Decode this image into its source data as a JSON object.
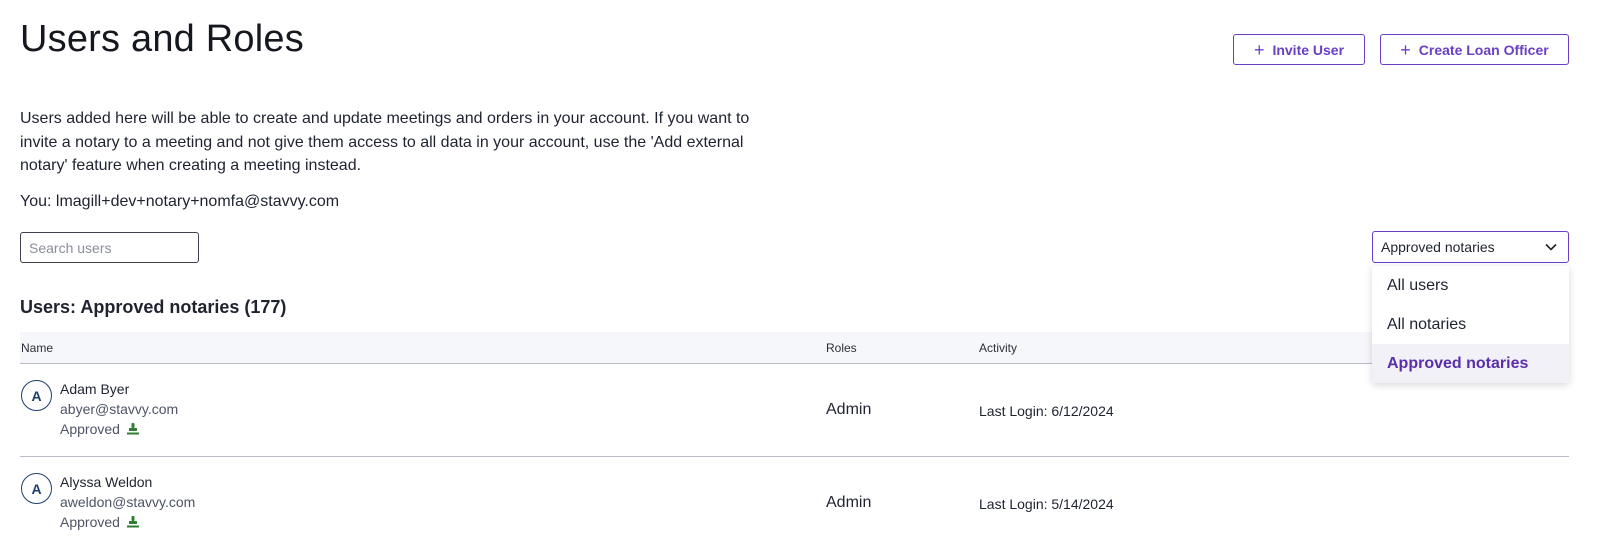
{
  "header": {
    "title": "Users and Roles",
    "invite_label": "Invite User",
    "create_loan_label": "Create Loan Officer"
  },
  "intro": {
    "description": "Users added here will be able to create and update meetings and orders in your account. If you want to invite a notary to a meeting and not give them access to all data in your account, use the 'Add external notary' feature when creating a meeting instead.",
    "you_label": "You: lmagill+dev+notary+nomfa@stavvy.com"
  },
  "search": {
    "placeholder": "Search users",
    "value": ""
  },
  "filter": {
    "selected": "Approved notaries",
    "options": [
      "All users",
      "All notaries",
      "Approved notaries"
    ]
  },
  "users_heading": "Users: Approved notaries (177)",
  "table": {
    "columns": [
      "Name",
      "Roles",
      "Activity"
    ],
    "rows": [
      {
        "initial": "A",
        "name": "Adam Byer",
        "email": "abyer@stavvy.com",
        "status": "Approved",
        "role": "Admin",
        "activity": "Last Login: 6/12/2024"
      },
      {
        "initial": "A",
        "name": "Alyssa Weldon",
        "email": "aweldon@stavvy.com",
        "status": "Approved",
        "role": "Admin",
        "activity": "Last Login: 5/14/2024"
      }
    ]
  },
  "colors": {
    "accent": "#6a3fc4",
    "avatar": "#1e3f6e",
    "approved_icon": "#2e7d32"
  },
  "icons": {
    "add": "plus-icon",
    "dropdown": "chevron-down-icon",
    "approved": "notary-stamp-icon"
  }
}
